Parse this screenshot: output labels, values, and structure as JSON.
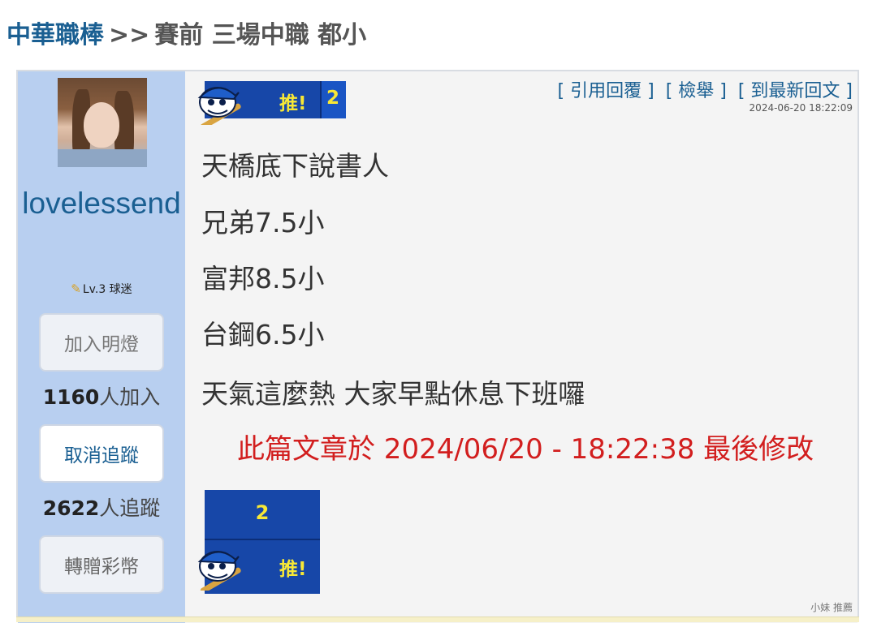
{
  "breadcrumb": {
    "forum": "中華職棒",
    "separator": ">>",
    "title": "賽前 三場中職 都小"
  },
  "author": {
    "username": "lovelessend",
    "level": "Lv.3 球迷",
    "level_icon": "baseball-bat-icon",
    "light_button": "加入明燈",
    "light_count": "1160",
    "light_suffix": "人加入",
    "follow_button": "取消追蹤",
    "follow_count": "2622",
    "follow_suffix": "人追蹤",
    "gift_button": "轉贈彩幣"
  },
  "post": {
    "push_label": "推!",
    "push_count": "2",
    "actions": {
      "quote_reply": "[ 引用回覆 ]",
      "report": "[ 檢舉 ]",
      "latest_reply": "[ 到最新回文 ]"
    },
    "timestamp": "2024-06-20 18:22:09",
    "lines": [
      "天橋底下說書人",
      "兄弟7.5小",
      "富邦8.5小",
      "台鋼6.5小",
      "天氣這麼熱 大家早點休息下班囉"
    ],
    "edited_note": "此篇文章於 2024/06/20 - 18:22:38 最後修改",
    "recommend": "小妹 推薦"
  },
  "colors": {
    "link_blue": "#1a5f92",
    "sidebar_blue": "#b8cff0",
    "push_blue": "#1747a8",
    "push_yellow": "#f7e836",
    "edit_red": "#d21e1e"
  }
}
